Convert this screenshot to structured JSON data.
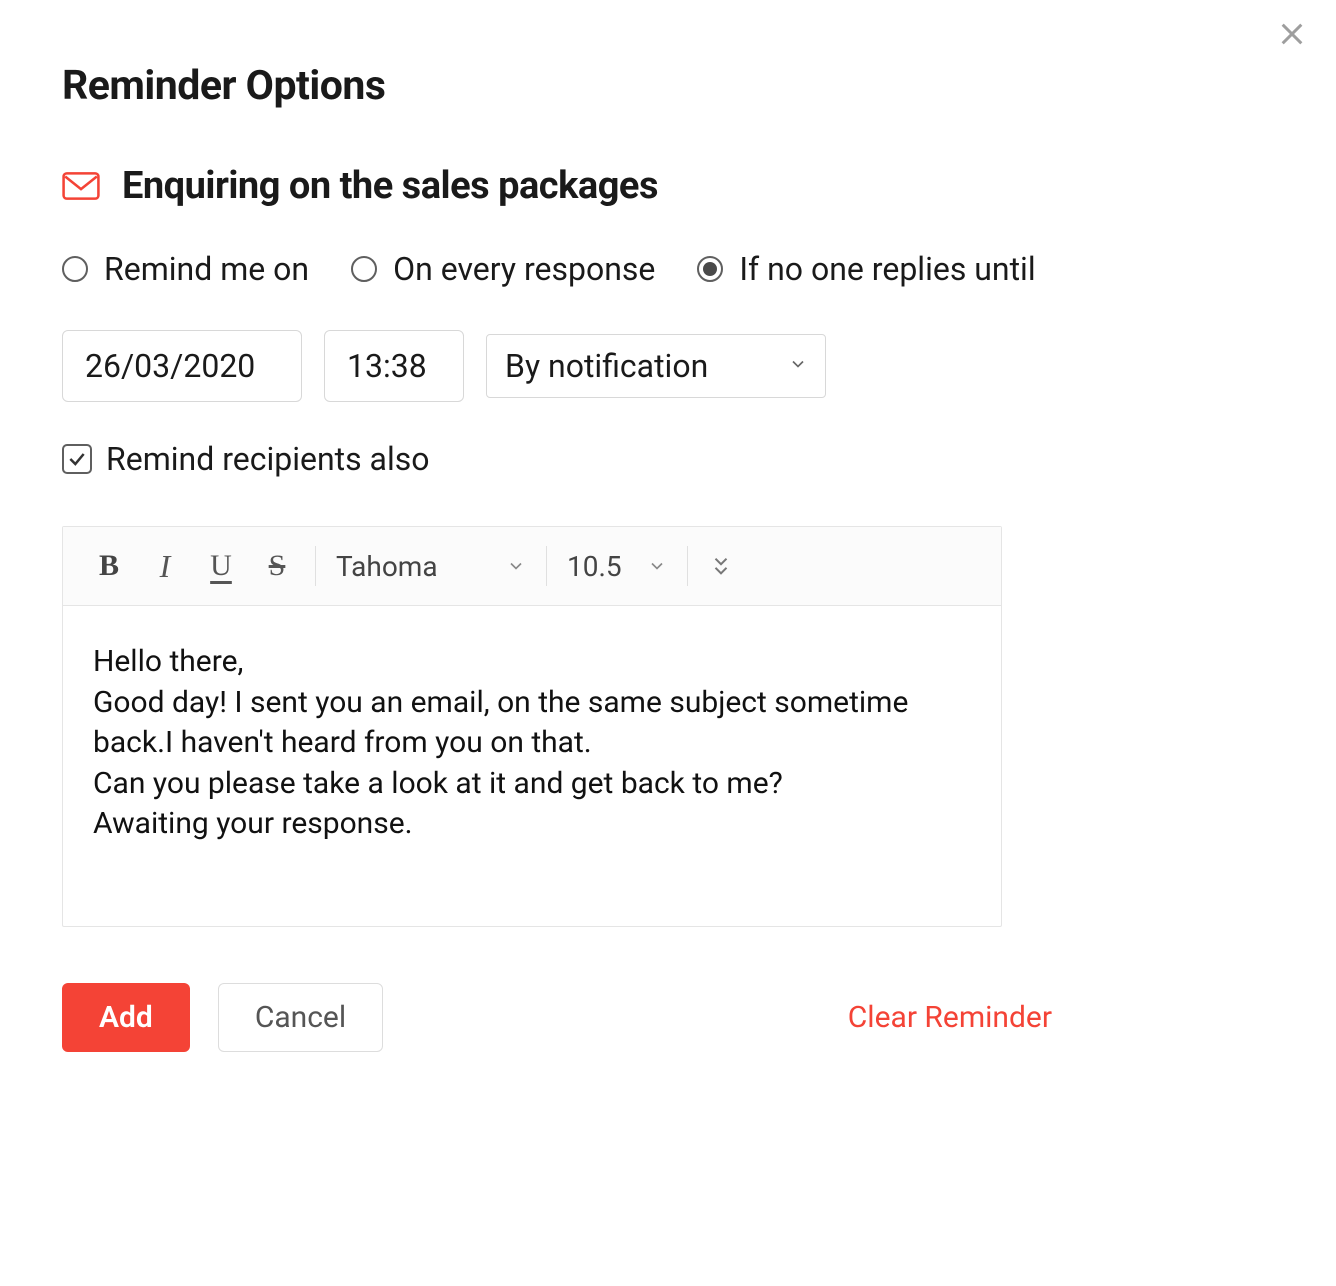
{
  "title": "Reminder Options",
  "subject": "Enquiring on the sales packages",
  "radios": {
    "remind_me_on": "Remind me on",
    "on_every_response": "On every response",
    "if_no_one_replies": "If no one replies until",
    "selected": "if_no_one_replies"
  },
  "inputs": {
    "date": "26/03/2020",
    "time": "13:38",
    "method": "By notification"
  },
  "checkbox": {
    "remind_recipients_label": "Remind recipients also",
    "checked": true
  },
  "toolbar": {
    "bold": "B",
    "italic": "I",
    "underline": "U",
    "strike": "S",
    "font": "Tahoma",
    "size": "10.5"
  },
  "body": "Hello there,\nGood day! I sent you an email, on the same subject sometime back.I haven't heard from you on that.\nCan you please take a look at it and get back to me?\nAwaiting your response.",
  "buttons": {
    "add": "Add",
    "cancel": "Cancel",
    "clear": "Clear Reminder"
  },
  "colors": {
    "accent": "#f44336"
  }
}
